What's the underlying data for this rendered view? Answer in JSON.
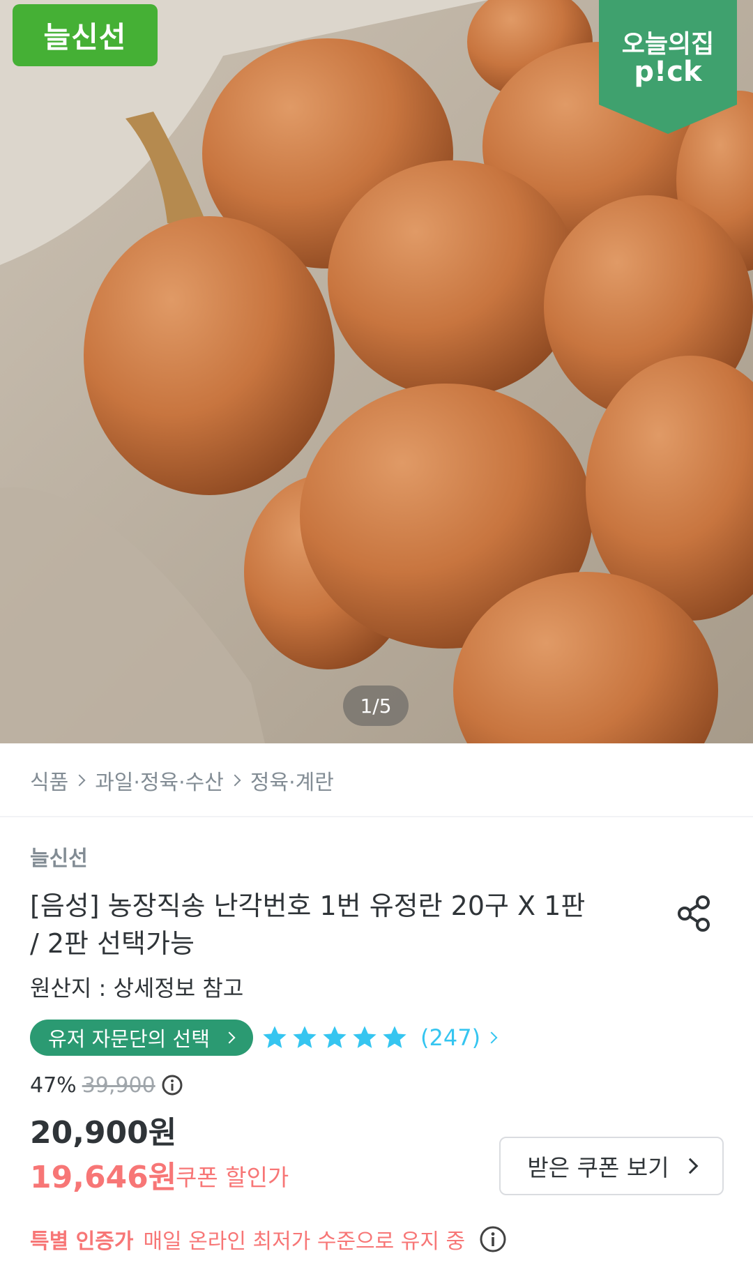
{
  "hero": {
    "brand_badge": "늘신선",
    "pick_badge": {
      "line1": "오늘의집",
      "line2": "p!ck"
    },
    "page_counter": "1/5",
    "pick_color": "#3fa16e"
  },
  "breadcrumb": [
    "식품",
    "과일·정육·수산",
    "정육·계란"
  ],
  "product": {
    "brand": "늘신선",
    "title": "[음성] 농장직송 난각번호 1번 유정란 20구 X 1판 / 2판 선택가능",
    "origin": "원산지 : 상세정보 참고",
    "advisor_badge": "유저 자문단의 선택",
    "rating_stars": 5,
    "review_count": "(247)",
    "discount_rate": "47%",
    "original_price": "39,900",
    "price": "20,900원",
    "coupon_price": "19,646원",
    "coupon_label": "쿠폰 할인가",
    "coupon_button": "받은 쿠폰 보기",
    "special_label": "특별 인증가",
    "special_text": "매일 온라인 최저가 수준으로 유지 중"
  },
  "icons": [
    "share-icon",
    "star-icon",
    "info-icon",
    "chevron-right-icon"
  ],
  "colors": {
    "accent_green": "#2b9a72",
    "brand_green": "#45b035",
    "star_blue": "#35c5f0",
    "sale_red": "#f77676"
  }
}
